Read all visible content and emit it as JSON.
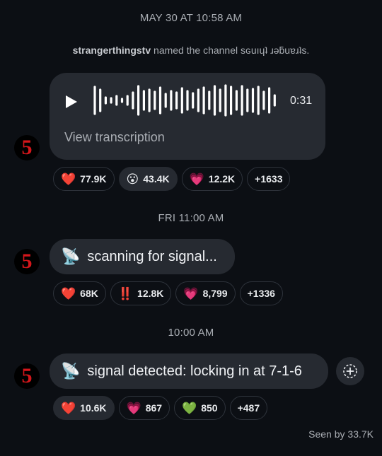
{
  "messages": [
    {
      "timestamp": "MAY 30 AT 10:58 AM",
      "system": {
        "user": "strangerthingstv",
        "text": " named the channel sɢuıɥʇ ɹǝƃuɐɹʇs."
      },
      "voice": {
        "duration": "0:31",
        "transcription_link": "View transcription"
      },
      "reactions": [
        {
          "emoji": "❤️",
          "count": "77.9K",
          "icon": "heart-red-icon"
        },
        {
          "emoji": "😮",
          "count": "43.4K",
          "icon": "surprised-face-icon",
          "highlighted": true
        },
        {
          "emoji": "💗",
          "count": "12.2K",
          "icon": "heart-pink-icon"
        },
        {
          "emoji": "",
          "count": "+1633"
        }
      ]
    },
    {
      "timestamp": "FRI 11:00 AM",
      "text": "scanning for signal...",
      "emoji": "📡",
      "reactions": [
        {
          "emoji": "❤️",
          "count": "68K",
          "icon": "heart-red-icon"
        },
        {
          "emoji": "‼️",
          "count": "12.8K",
          "icon": "double-exclamation-icon"
        },
        {
          "emoji": "💗",
          "count": "8,799",
          "icon": "heart-pink-icon"
        },
        {
          "emoji": "",
          "count": "+1336"
        }
      ]
    },
    {
      "timestamp": "10:00 AM",
      "text": "signal detected: locking in at 7-1-6",
      "emoji": "📡",
      "reactions": [
        {
          "emoji": "❤️",
          "count": "10.6K",
          "icon": "heart-red-icon",
          "highlighted": true
        },
        {
          "emoji": "💗",
          "count": "867",
          "icon": "heart-pink-icon"
        },
        {
          "emoji": "💚",
          "count": "850",
          "icon": "heart-green-icon"
        },
        {
          "emoji": "",
          "count": "+487"
        }
      ]
    }
  ],
  "avatar": {
    "glyph": "5",
    "color": "#d4161b"
  },
  "seen": "Seen by 33.7K",
  "colors": {
    "background": "#0c0f14",
    "bubble": "#262a31",
    "muted": "#a9adb3"
  }
}
